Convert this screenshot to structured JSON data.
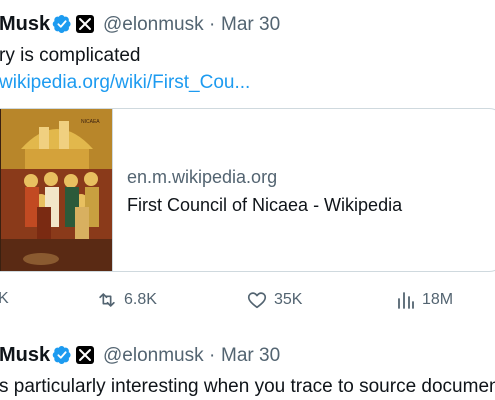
{
  "tweet1": {
    "author_name": "Musk",
    "handle": "@elonmusk",
    "separator": "·",
    "date": "Mar 30",
    "text": "ry is complicated",
    "link_text": "wikipedia.org/wiki/First_Cou..."
  },
  "card": {
    "domain": "en.m.wikipedia.org",
    "title": "First Council of Nicaea - Wikipedia"
  },
  "metrics": {
    "replies": "K",
    "reposts": "6.8K",
    "likes": "35K",
    "views": "18M"
  },
  "tweet2": {
    "author_name": "Musk",
    "handle": "@elonmusk",
    "separator": "·",
    "date": "Mar 30",
    "text": "s particularly interesting when you trace to source documents"
  },
  "colors": {
    "text": "#0f1419",
    "secondary": "#536471",
    "link": "#1d9bf0",
    "verified": "#1d9bf0",
    "border": "#cfd9de"
  }
}
